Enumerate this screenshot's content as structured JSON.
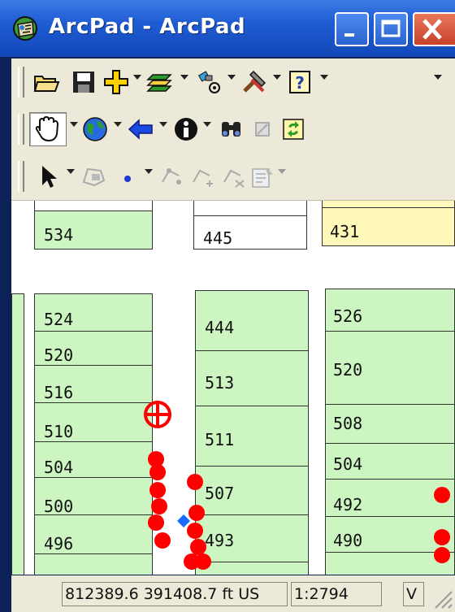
{
  "window": {
    "title": "ArcPad - ArcPad"
  },
  "colors": {
    "parcel_fill": "#ccf5c2",
    "highlight_fill": "#fff8b8",
    "gps_point": "#ff0000",
    "target": "#ff0000"
  },
  "toolbars": {
    "file": [
      "open-icon",
      "save-icon",
      "add-layer-icon",
      "layers-icon",
      "gps-icon",
      "tools-icon",
      "help-icon"
    ],
    "navigation": [
      "pan-icon",
      "zoom-globe-icon",
      "back-arrow-icon",
      "identify-icon",
      "find-icon",
      "clear-icon",
      "refresh-icon"
    ],
    "edit": [
      "select-arrow-icon",
      "polygon-icon",
      "point-icon",
      "vertex-icon",
      "add-vertex-icon",
      "move-vertex-icon",
      "properties-icon"
    ]
  },
  "map": {
    "parcels": [
      {
        "label": "534"
      },
      {
        "label": "445"
      },
      {
        "label": "431"
      },
      {
        "label": "524"
      },
      {
        "label": "520"
      },
      {
        "label": "516"
      },
      {
        "label": "510"
      },
      {
        "label": "504"
      },
      {
        "label": "500"
      },
      {
        "label": "496"
      },
      {
        "label": "444"
      },
      {
        "label": "513"
      },
      {
        "label": "511"
      },
      {
        "label": "507"
      },
      {
        "label": "493"
      },
      {
        "label": "526"
      },
      {
        "label": "520"
      },
      {
        "label": "508"
      },
      {
        "label": "504"
      },
      {
        "label": "492"
      },
      {
        "label": "490"
      }
    ]
  },
  "status": {
    "coordinates": "812389.6 391408.7 ft US",
    "scale": "1:2794",
    "mode": "V"
  }
}
